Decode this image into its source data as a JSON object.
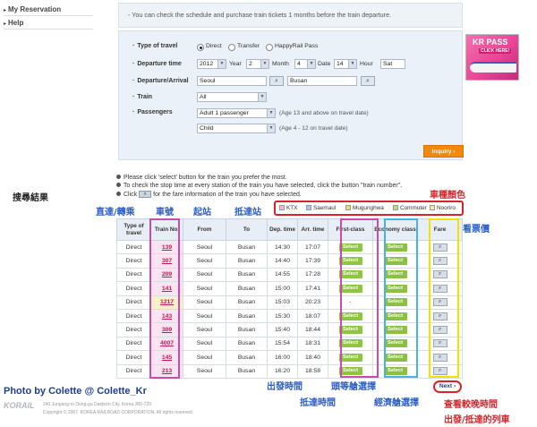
{
  "sidebar": {
    "items": [
      {
        "label": "My Reservation"
      },
      {
        "label": "Help"
      }
    ]
  },
  "notice": "- You can check the schedule and purchase train tickets 1 months before the train departure.",
  "form": {
    "type_of_travel": {
      "label": "Type of travel",
      "options": [
        "Direct",
        "Transfer",
        "HappyRail Pass"
      ],
      "selected": "Direct"
    },
    "departure_time": {
      "label": "Departure time",
      "year": "2012",
      "year_unit": "Year",
      "month": "2",
      "month_unit": "Month",
      "date": "4",
      "date_unit": "Date",
      "hour": "14",
      "hour_unit": "Hour",
      "extra": "Sat"
    },
    "dep_arr": {
      "label": "Departure/Arrival",
      "departure": "Seoul",
      "arrival": "Busan"
    },
    "train": {
      "label": "Train",
      "value": "All"
    },
    "passengers": {
      "label": "Passengers",
      "adult": "Adult 1 passenger",
      "adult_note": "(Age 13 and above on travel date)",
      "child": "Child",
      "child_note": "(Age 4 - 12 on travel date)"
    },
    "inquiry_label": "Inquiry"
  },
  "promo": {
    "line1": "KR PASS",
    "line2": "CLICK HERE!"
  },
  "instructions": [
    "Please click 'select' button for the train you prefer the most.",
    "To check the stop time at every station of the train you have selected, click the button \"train number\".",
    "Click",
    "for the fare information of the train you have selected."
  ],
  "legend": {
    "items": [
      {
        "label": "KTX",
        "color": "#f3b6d4"
      },
      {
        "label": "Saemaul",
        "color": "#a9c8ea"
      },
      {
        "label": "Mugunghwa",
        "color": "#f7d56e"
      },
      {
        "label": "Commuter",
        "color": "#b9df8a"
      },
      {
        "label": "Nooriro",
        "color": "#f5ea9c"
      }
    ]
  },
  "table": {
    "headers": [
      "Type of travel",
      "Train No.",
      "From",
      "To",
      "Dep. time",
      "Arr. time",
      "First-class",
      "Economy class",
      "Fare"
    ],
    "select_label": "Select",
    "fare_icon": "search-icon",
    "rows": [
      {
        "type": "Direct",
        "no": "139",
        "from": "Seoul",
        "to": "Busan",
        "dep": "14:30",
        "arr": "17:07",
        "first": "Select",
        "eco": "Select"
      },
      {
        "type": "Direct",
        "no": "307",
        "from": "Seoul",
        "to": "Busan",
        "dep": "14:40",
        "arr": "17:39",
        "first": "Select",
        "eco": "Select"
      },
      {
        "type": "Direct",
        "no": "209",
        "from": "Seoul",
        "to": "Busan",
        "dep": "14:55",
        "arr": "17:28",
        "first": "Select",
        "eco": "Select"
      },
      {
        "type": "Direct",
        "no": "141",
        "from": "Seoul",
        "to": "Busan",
        "dep": "15:00",
        "arr": "17:41",
        "first": "Select",
        "eco": "Select"
      },
      {
        "type": "Direct",
        "no": "1217",
        "from": "Seoul",
        "to": "Busan",
        "dep": "15:03",
        "arr": "20:23",
        "first": "-",
        "eco": "Select"
      },
      {
        "type": "Direct",
        "no": "143",
        "from": "Seoul",
        "to": "Busan",
        "dep": "15:30",
        "arr": "18:07",
        "first": "Select",
        "eco": "Select"
      },
      {
        "type": "Direct",
        "no": "309",
        "from": "Seoul",
        "to": "Busan",
        "dep": "15:40",
        "arr": "18:44",
        "first": "Select",
        "eco": "Select"
      },
      {
        "type": "Direct",
        "no": "4007",
        "from": "Seoul",
        "to": "Busan",
        "dep": "15:54",
        "arr": "18:31",
        "first": "Select",
        "eco": "Select"
      },
      {
        "type": "Direct",
        "no": "145",
        "from": "Seoul",
        "to": "Busan",
        "dep": "16:00",
        "arr": "18:40",
        "first": "Select",
        "eco": "Select"
      },
      {
        "type": "Direct",
        "no": "213",
        "from": "Seoul",
        "to": "Busan",
        "dep": "16:20",
        "arr": "18:58",
        "first": "Select",
        "eco": "Select"
      }
    ]
  },
  "next_label": "Next",
  "annotations": {
    "search_results": "搜尋結果",
    "train_colors": "車種顏色",
    "direct_transfer": "直達/轉乘",
    "train_no": "車號",
    "origin": "起站",
    "destination": "抵達站",
    "check_fare": "查看票價",
    "dep_time": "出發時間",
    "first_class": "頭等艙選擇",
    "arr_time": "抵達時間",
    "economy": "經濟艙選擇",
    "later_times": "查看較晚時間",
    "later_trains": "出發/抵達的列車"
  },
  "footer": {
    "photo_credit": "Photo by Colette @ Colette_Kr",
    "brand": "KORAIL",
    "address": "240 Jungang-ro Dong-gu Daejeon City, Korea 300-720",
    "copyright": "Copyright © 2007. KOREA RAILROAD CORPORATION. All rights reserved."
  }
}
